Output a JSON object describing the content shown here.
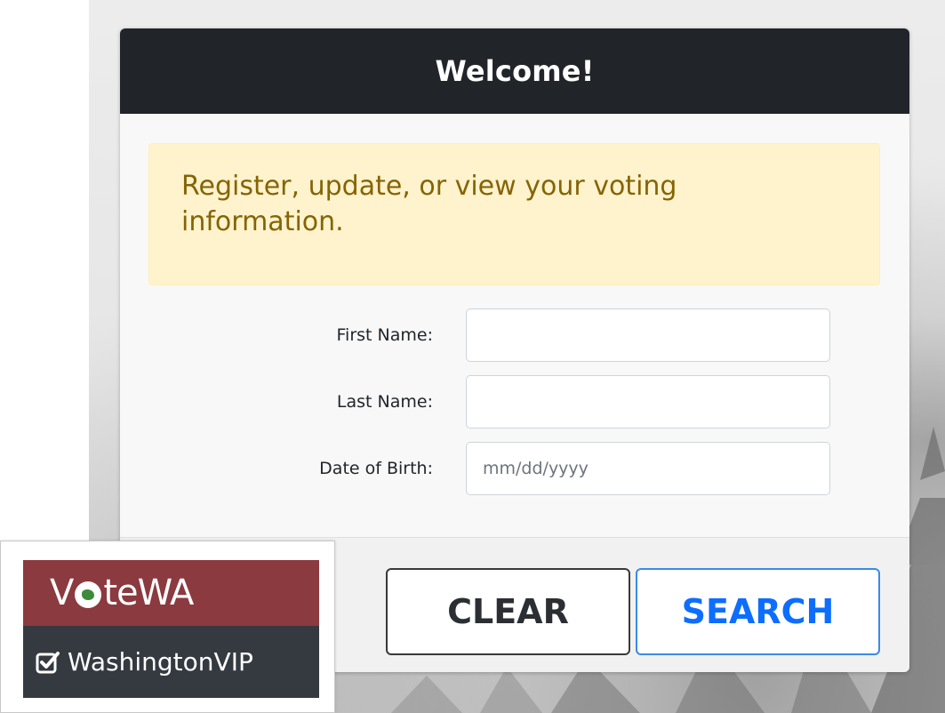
{
  "header": {
    "title": "Welcome!"
  },
  "alert": {
    "message": "Register, update, or view your voting information."
  },
  "form": {
    "first_name": {
      "label": "First Name:",
      "value": "",
      "placeholder": ""
    },
    "last_name": {
      "label": "Last Name:",
      "value": "",
      "placeholder": ""
    },
    "dob": {
      "label": "Date of Birth:",
      "value": "",
      "placeholder": "mm/dd/yyyy"
    }
  },
  "buttons": {
    "clear_label": "CLEAR",
    "search_label": "SEARCH"
  },
  "logo": {
    "brand_pre": "V",
    "brand_post": "teWA",
    "subtitle": "WashingtonVIP",
    "icon": "checkbox-checked-icon"
  },
  "colors": {
    "header_bg": "#212529",
    "alert_bg": "#fff3cd",
    "alert_text": "#856404",
    "search_accent": "#0d6efd",
    "logo_top": "#8b3a3f",
    "logo_bottom": "#343a40"
  }
}
